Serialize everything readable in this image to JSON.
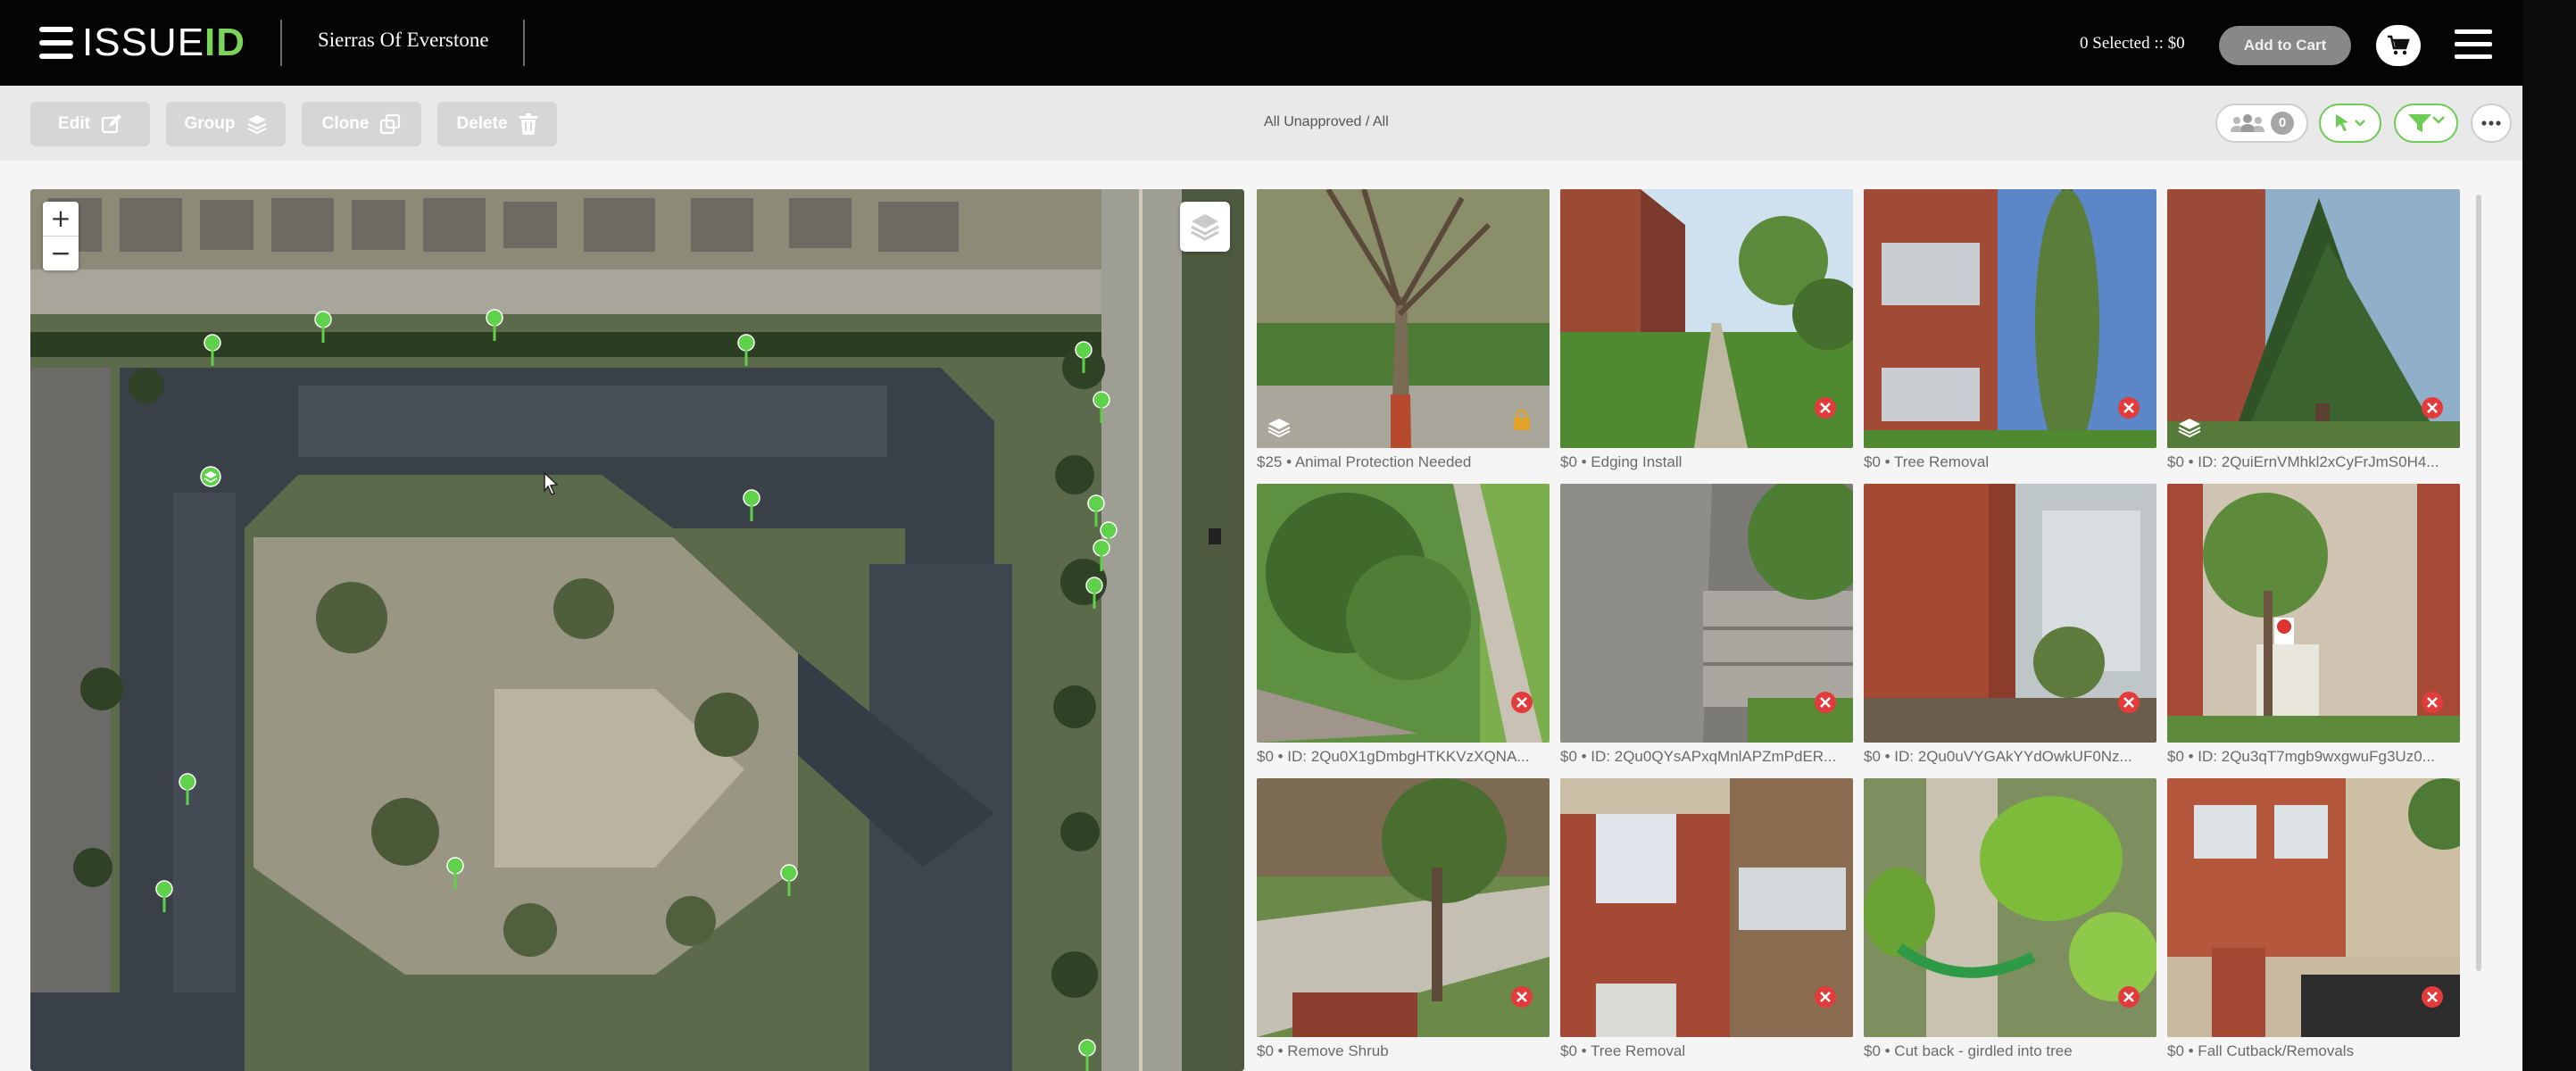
{
  "header": {
    "logo_text_a": "ISSUE",
    "logo_text_b": "ID",
    "project_name": "Sierras Of Everstone",
    "selection_summary": "0 Selected :: $0",
    "add_to_cart_label": "Add to Cart"
  },
  "toolbar": {
    "buttons": [
      {
        "label": "Edit",
        "icon": "edit-icon"
      },
      {
        "label": "Group",
        "icon": "layers-icon"
      },
      {
        "label": "Clone",
        "icon": "copy-icon"
      },
      {
        "label": "Delete",
        "icon": "trash-icon"
      }
    ],
    "filter_label": "All Unapproved / All",
    "people_count": "0"
  },
  "map": {
    "zoom_in": "+",
    "zoom_out": "−"
  },
  "issues": [
    {
      "label": "$25 • Animal Protection Needed",
      "status": "pending",
      "layer": true
    },
    {
      "label": "$0 • Edging Install",
      "status": "rejected",
      "layer": false
    },
    {
      "label": "$0 • Tree Removal",
      "status": "rejected",
      "layer": false
    },
    {
      "label": "$0 • ID: 2QuiErnVMhkl2xCyFrJmS0H4...",
      "status": "rejected",
      "layer": true
    },
    {
      "label": "$0 • ID: 2Qu0X1gDmbgHTKKVzXQNA...",
      "status": "rejected",
      "layer": false
    },
    {
      "label": "$0 • ID: 2Qu0QYsAPxqMnlAPZmPdER...",
      "status": "rejected",
      "layer": false
    },
    {
      "label": "$0 • ID: 2Qu0uVYGAkYYdOwkUF0Nz...",
      "status": "rejected",
      "layer": false
    },
    {
      "label": "$0 • ID: 2Qu3qT7mgb9wxgwuFg3Uz0...",
      "status": "rejected",
      "layer": false
    },
    {
      "label": "$0 • Remove Shrub",
      "status": "rejected",
      "layer": false
    },
    {
      "label": "$0 • Tree Removal",
      "status": "rejected",
      "layer": false
    },
    {
      "label": "$0 • Cut back - girdled into tree",
      "status": "rejected",
      "layer": false
    },
    {
      "label": "$0 • Fall Cutback/Removals",
      "status": "rejected",
      "layer": false
    }
  ]
}
